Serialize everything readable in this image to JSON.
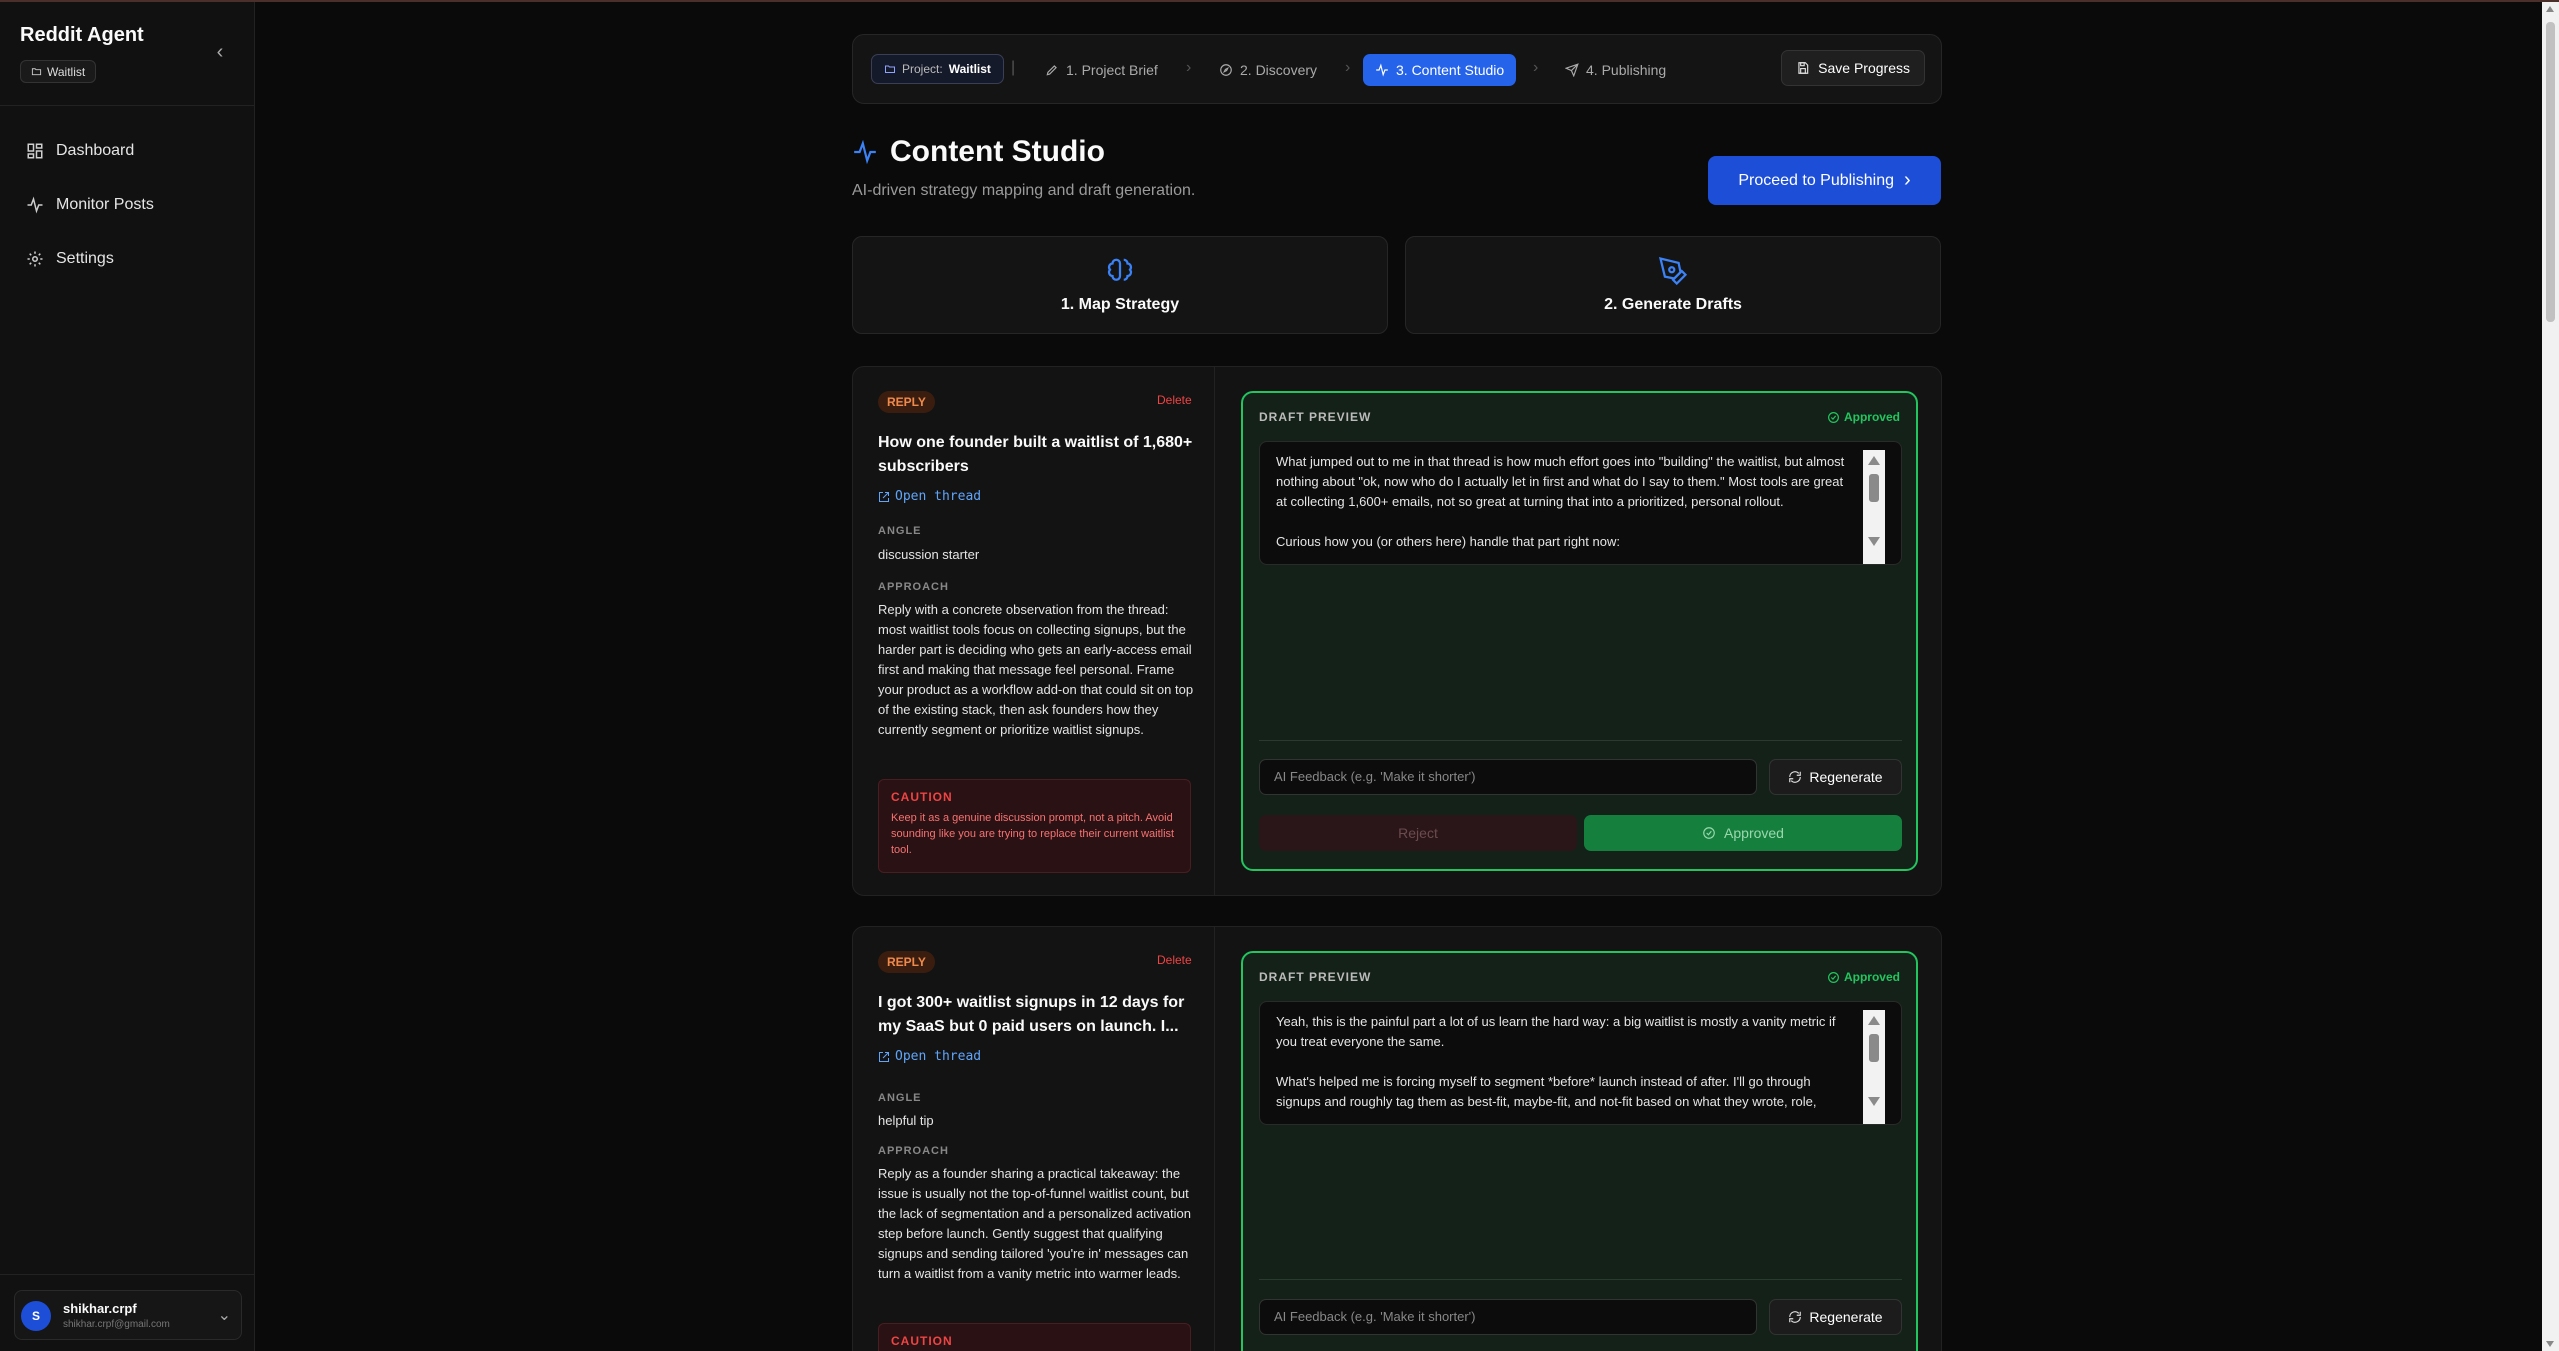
{
  "sidebar": {
    "brand": "Reddit Agent",
    "workspace": "Waitlist",
    "items": [
      {
        "label": "Dashboard",
        "icon": "dashboard-icon"
      },
      {
        "label": "Monitor Posts",
        "icon": "activity-icon"
      },
      {
        "label": "Settings",
        "icon": "gear-icon"
      }
    ],
    "user": {
      "initial": "S",
      "name": "shikhar.crpf",
      "email": "shikhar.crpf@gmail.com"
    }
  },
  "stepbar": {
    "project_prefix": "Project:",
    "project_name": "Waitlist",
    "steps": [
      {
        "label": "1. Project Brief",
        "icon": "pencil-icon",
        "active": false
      },
      {
        "label": "2. Discovery",
        "icon": "compass-icon",
        "active": false
      },
      {
        "label": "3. Content Studio",
        "icon": "activity-icon",
        "active": true
      },
      {
        "label": "4. Publishing",
        "icon": "send-icon",
        "active": false
      }
    ],
    "save_label": "Save Progress"
  },
  "header": {
    "title": "Content Studio",
    "subtitle": "AI-driven strategy mapping and draft generation.",
    "proceed_label": "Proceed to Publishing"
  },
  "modes": [
    {
      "label": "1. Map Strategy",
      "icon": "brain-icon"
    },
    {
      "label": "2. Generate Drafts",
      "icon": "pen-tool-icon"
    }
  ],
  "threads": [
    {
      "tag": "REPLY",
      "delete_label": "Delete",
      "title": "How one founder built a waitlist of 1,680+ subscribers",
      "open_label": "Open thread",
      "angle_label": "ANGLE",
      "angle": "discussion starter",
      "approach_label": "APPROACH",
      "approach": "Reply with a concrete observation from the thread: most waitlist tools focus on collecting signups, but the harder part is deciding who gets an early-access email first and making that message feel personal. Frame your product as a workflow add-on that could sit on top of the existing stack, then ask founders how they currently segment or prioritize waitlist signups.",
      "caution_label": "CAUTION",
      "caution": "Keep it as a genuine discussion prompt, not a pitch. Avoid sounding like you are trying to replace their current waitlist tool.",
      "draft_label": "DRAFT PREVIEW",
      "status": "Approved",
      "draft": "What jumped out to me in that thread is how much effort goes into \"building\" the waitlist, but almost nothing about \"ok, now who do I actually let in first and what do I say to them.\" Most tools are great at collecting 1,600+ emails, not so great at turning that into a prioritized, personal rollout.\n\nCurious how you (or others here) handle that part right now:",
      "feedback_placeholder": "AI Feedback (e.g. 'Make it shorter')",
      "regenerate_label": "Regenerate",
      "reject_label": "Reject",
      "approve_label": "Approved"
    },
    {
      "tag": "REPLY",
      "delete_label": "Delete",
      "title": "I got 300+ waitlist signups in 12 days for my SaaS but 0 paid users on launch. I...",
      "open_label": "Open thread",
      "angle_label": "ANGLE",
      "angle": "helpful tip",
      "approach_label": "APPROACH",
      "approach": "Reply as a founder sharing a practical takeaway: the issue is usually not the top-of-funnel waitlist count, but the lack of segmentation and a personalized activation step before launch. Gently suggest that qualifying signups and sending tailored 'you're in' messages can turn a waitlist from a vanity metric into warmer leads.",
      "caution_label": "CAUTION",
      "draft_label": "DRAFT PREVIEW",
      "status": "Approved",
      "draft": "Yeah, this is the painful part a lot of us learn the hard way: a big waitlist is mostly a vanity metric if you treat everyone the same.\n\nWhat's helped me is forcing myself to segment *before* launch instead of after. I'll go through signups and roughly tag them as best-fit, maybe-fit, and not-fit based on what they wrote, role, company size, etc. Even a dumb spreadsheet with three tabs is better than blasting one",
      "feedback_placeholder": "AI Feedback (e.g. 'Make it shorter')",
      "regenerate_label": "Regenerate"
    }
  ]
}
